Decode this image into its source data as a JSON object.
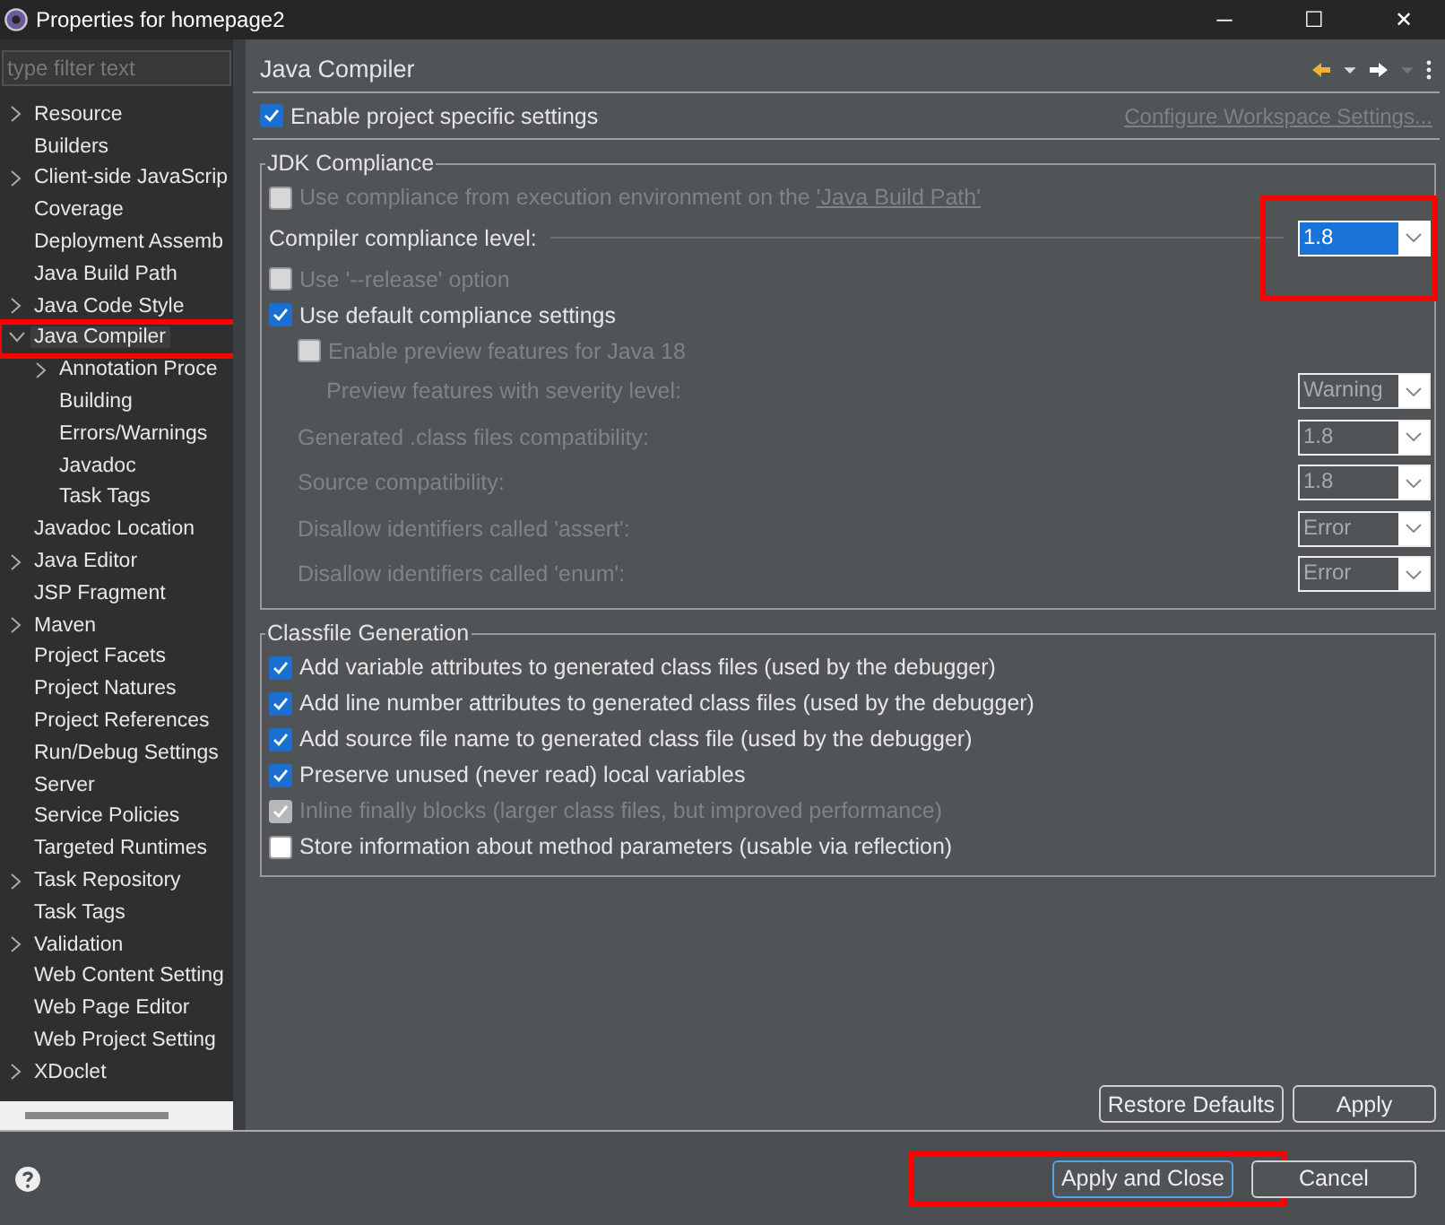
{
  "window": {
    "title": "Properties for homepage2",
    "controls": [
      "─",
      "☐",
      "✕"
    ]
  },
  "sidebar": {
    "filter": {
      "placeholder": "type filter text"
    },
    "items": [
      {
        "label": "Resource",
        "expandable": true,
        "selected": false
      },
      {
        "label": "Builders",
        "expandable": false,
        "selected": false
      },
      {
        "label": "Client-side JavaScrip",
        "expandable": true,
        "selected": false
      },
      {
        "label": "Coverage",
        "expandable": false,
        "selected": false
      },
      {
        "label": "Deployment Assemb",
        "expandable": false,
        "selected": false
      },
      {
        "label": "Java Build Path",
        "expandable": false,
        "selected": false
      },
      {
        "label": "Java Code Style",
        "expandable": true,
        "selected": false
      },
      {
        "label": "Java Compiler",
        "expandable": true,
        "selected": true,
        "highlighted": true,
        "children": [
          {
            "label": "Annotation Proce",
            "expandable": true,
            "selected": false
          },
          {
            "label": "Building",
            "expandable": false,
            "selected": false
          },
          {
            "label": "Errors/Warnings",
            "expandable": false,
            "selected": false
          },
          {
            "label": "Javadoc",
            "expandable": false,
            "selected": false
          },
          {
            "label": "Task Tags",
            "expandable": false,
            "selected": false
          }
        ]
      },
      {
        "label": "Javadoc Location",
        "expandable": false,
        "selected": false
      },
      {
        "label": "Java Editor",
        "expandable": true,
        "selected": false
      },
      {
        "label": "JSP Fragment",
        "expandable": false,
        "selected": false
      },
      {
        "label": "Maven",
        "expandable": true,
        "selected": false
      },
      {
        "label": "Project Facets",
        "expandable": false,
        "selected": false
      },
      {
        "label": "Project Natures",
        "expandable": false,
        "selected": false
      },
      {
        "label": "Project References",
        "expandable": false,
        "selected": false
      },
      {
        "label": "Run/Debug Settings",
        "expandable": false,
        "selected": false
      },
      {
        "label": "Server",
        "expandable": false,
        "selected": false
      },
      {
        "label": "Service Policies",
        "expandable": false,
        "selected": false
      },
      {
        "label": "Targeted Runtimes",
        "expandable": false,
        "selected": false
      },
      {
        "label": "Task Repository",
        "expandable": true,
        "selected": false
      },
      {
        "label": "Task Tags",
        "expandable": false,
        "selected": false
      },
      {
        "label": "Validation",
        "expandable": true,
        "selected": false
      },
      {
        "label": "Web Content Setting",
        "expandable": false,
        "selected": false
      },
      {
        "label": "Web Page Editor",
        "expandable": false,
        "selected": false
      },
      {
        "label": "Web Project Setting",
        "expandable": false,
        "selected": false
      },
      {
        "label": "XDoclet",
        "expandable": true,
        "selected": false
      }
    ]
  },
  "page": {
    "title": "Java Compiler",
    "enable_project": {
      "label": "Enable project specific settings",
      "checked": true
    },
    "workspace_link": "Configure Workspace Settings...",
    "groups": [
      {
        "title": "JDK Compliance",
        "rows": [
          {
            "kind": "checkbox",
            "label": "Use compliance from execution environment on the ",
            "link": "'Java Build Path'",
            "checked": false,
            "disabled": true
          },
          {
            "kind": "combo",
            "label": "Compiler compliance level:",
            "value": "1.8",
            "disabled": false,
            "highlighted": true
          },
          {
            "kind": "checkbox",
            "label": "Use '--release' option",
            "checked": false,
            "disabled": true
          },
          {
            "kind": "checkbox",
            "label": "Use default compliance settings",
            "checked": true,
            "disabled": false,
            "children": [
              {
                "kind": "checkbox",
                "label": "Enable preview features for Java 18",
                "checked": false,
                "disabled": true,
                "children": [
                  {
                    "kind": "combo",
                    "label": "Preview features with severity level:",
                    "value": "Warning",
                    "disabled": true
                  }
                ]
              },
              {
                "kind": "combo",
                "label": "Generated .class files compatibility:",
                "value": "1.8",
                "disabled": true
              },
              {
                "kind": "combo",
                "label": "Source compatibility:",
                "value": "1.8",
                "disabled": true
              },
              {
                "kind": "combo",
                "label": "Disallow identifiers called 'assert':",
                "value": "Error",
                "disabled": true
              },
              {
                "kind": "combo",
                "label": "Disallow identifiers called 'enum':",
                "value": "Error",
                "disabled": true
              }
            ]
          }
        ]
      },
      {
        "title": "Classfile Generation",
        "rows": [
          {
            "kind": "checkbox",
            "label": "Add variable attributes to generated class files (used by the debugger)",
            "checked": true,
            "disabled": false
          },
          {
            "kind": "checkbox",
            "label": "Add line number attributes to generated class files (used by the debugger)",
            "checked": true,
            "disabled": false
          },
          {
            "kind": "checkbox",
            "label": "Add source file name to generated class file (used by the debugger)",
            "checked": true,
            "disabled": false
          },
          {
            "kind": "checkbox",
            "label": "Preserve unused (never read) local variables",
            "checked": true,
            "disabled": false
          },
          {
            "kind": "checkbox",
            "label": "Inline finally blocks (larger class files, but improved performance)",
            "checked": true,
            "disabled": true
          },
          {
            "kind": "checkbox",
            "label": "Store information about method parameters (usable via reflection)",
            "checked": false,
            "disabled": false
          }
        ]
      }
    ],
    "buttons": [
      {
        "label": "Restore Defaults"
      },
      {
        "label": "Apply"
      }
    ]
  },
  "footer": {
    "buttons": [
      {
        "label": "Apply and Close",
        "default": true,
        "highlighted": true
      },
      {
        "label": "Cancel",
        "default": false
      }
    ]
  }
}
